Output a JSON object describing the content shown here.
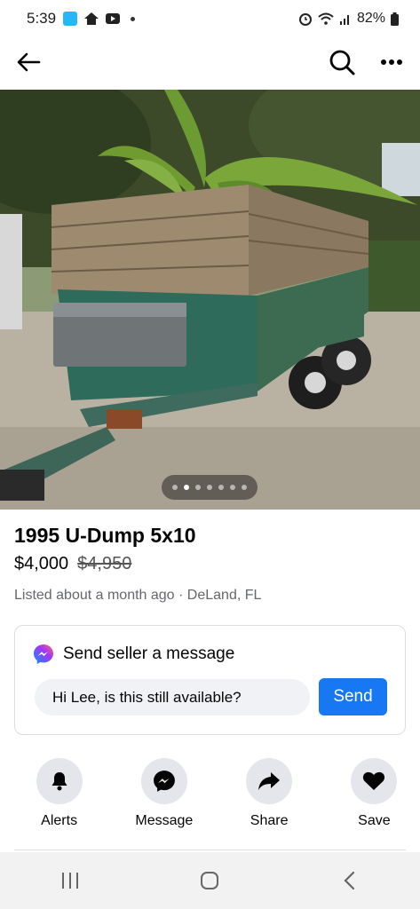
{
  "status_bar": {
    "time": "5:39",
    "battery": "82%",
    "icons": [
      "chat-app-icon",
      "home-icon",
      "youtube-icon",
      "alarm-icon",
      "wifi-icon",
      "signal-icon",
      "battery-icon"
    ]
  },
  "app_bar": {
    "icons": [
      "back-arrow-icon",
      "search-icon",
      "more-icon"
    ]
  },
  "gallery": {
    "total_images": 7,
    "active_index": 1
  },
  "listing": {
    "title": "1995 U-Dump 5x10",
    "price": "$4,000",
    "original_price": "$4,950",
    "meta": "Listed about a month ago · DeLand, FL"
  },
  "message_card": {
    "heading": "Send seller a message",
    "input_value": "Hi Lee, is this still available?",
    "send_label": "Send"
  },
  "actions": [
    {
      "label": "Alerts",
      "icon": "bell-icon"
    },
    {
      "label": "Message",
      "icon": "messenger-icon"
    },
    {
      "label": "Share",
      "icon": "share-icon"
    },
    {
      "label": "Save",
      "icon": "heart-icon"
    }
  ],
  "colors": {
    "accent": "#1877f2",
    "secondary_text": "#65676b",
    "action_bg": "#e4e6eb",
    "input_bg": "#f0f2f5"
  }
}
